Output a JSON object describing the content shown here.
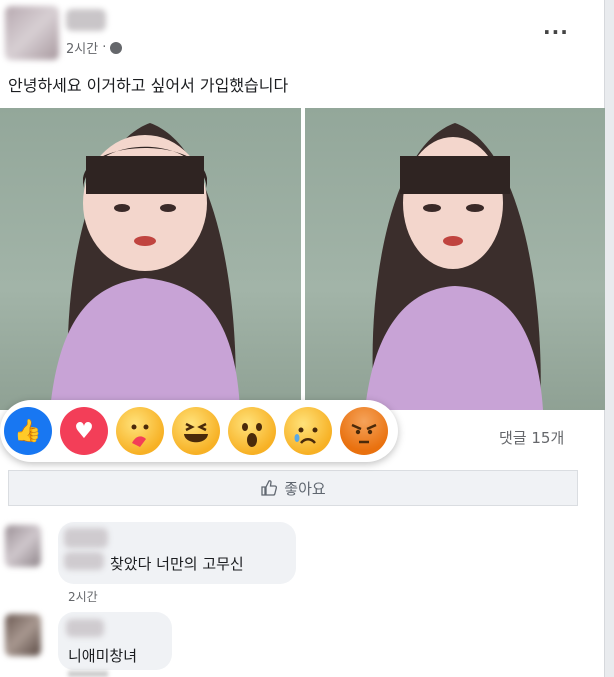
{
  "post": {
    "time": "2시간",
    "text": "안녕하세요 이거하고 싶어서 가입했습니다",
    "more": "···"
  },
  "reactions": [
    {
      "name": "like-reaction",
      "glyph": "👍"
    },
    {
      "name": "love-reaction",
      "glyph": "♥"
    },
    {
      "name": "care-reaction",
      "glyph": ""
    },
    {
      "name": "haha-reaction",
      "glyph": ""
    },
    {
      "name": "wow-reaction",
      "glyph": ""
    },
    {
      "name": "sad-reaction",
      "glyph": ""
    },
    {
      "name": "angry-reaction",
      "glyph": ""
    }
  ],
  "stats": {
    "comments": "댓글 15개"
  },
  "actions": {
    "like_label": "좋아요"
  },
  "comments": [
    {
      "text": "찾았다 너만의 고무신",
      "time": "2시간"
    },
    {
      "text": "니애미창녀"
    }
  ],
  "colors": {
    "accent": "#1877f2",
    "love": "#f33e58",
    "bubble": "#f0f2f5"
  }
}
